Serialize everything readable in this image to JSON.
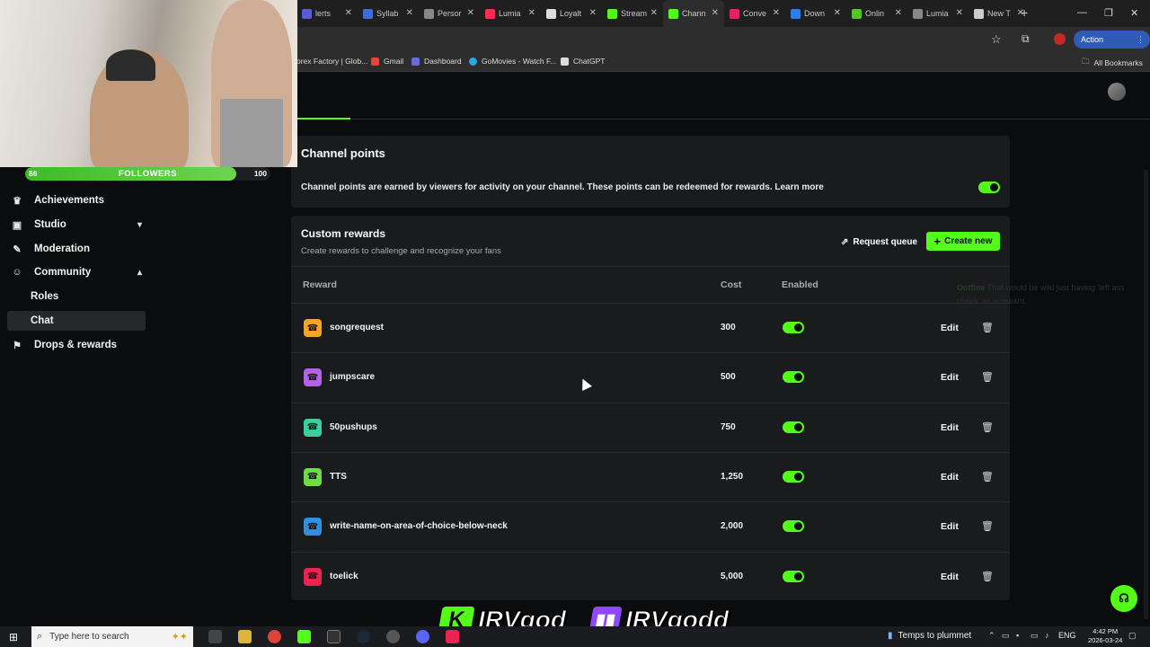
{
  "browser": {
    "tabs": [
      {
        "label": "lerts",
        "color": "#5b5bd6"
      },
      {
        "label": "Syllab",
        "color": "#3b6fd6"
      },
      {
        "label": "Persor",
        "color": "#888888"
      },
      {
        "label": "Lumia",
        "color": "#ff2d55"
      },
      {
        "label": "Loyalt",
        "color": "#dddddd"
      },
      {
        "label": "Stream",
        "color": "#53fc18"
      },
      {
        "label": "Chann",
        "color": "#53fc18"
      },
      {
        "label": "Conve",
        "color": "#e0245e"
      },
      {
        "label": "Down",
        "color": "#2b7de9"
      },
      {
        "label": "Onlin",
        "color": "#53c42b"
      },
      {
        "label": "Lumia",
        "color": "#888888"
      },
      {
        "label": "New T",
        "color": "#cccccc"
      }
    ],
    "action_required": "Action required",
    "bookmarks": [
      {
        "label": "orex Factory | Glob...",
        "color": "#cc3333"
      },
      {
        "label": "Gmail",
        "color": "#ea4335"
      },
      {
        "label": "Dashboard",
        "color": "#6a6ad6"
      },
      {
        "label": "GoMovies - Watch F...",
        "color": "#2ba6de"
      },
      {
        "label": "ChatGPT",
        "color": "#dddddd"
      }
    ],
    "all_bookmarks": "All Bookmarks"
  },
  "stream_overlay": {
    "followers_label": "FOLLOWERS",
    "followers_current": "86",
    "followers_goal": "100",
    "followers_progress": 0.86,
    "kick_name": "IRVgod",
    "twitch_name": "IRVgodd"
  },
  "sidebar": {
    "items": [
      {
        "label": "Achievements",
        "icon": "trophy-icon",
        "glyph": "🏆"
      },
      {
        "label": "Studio",
        "icon": "studio-icon",
        "glyph": "▣",
        "chevron": "⌄"
      },
      {
        "label": "Moderation",
        "icon": "wrench-icon",
        "glyph": "🔧"
      },
      {
        "label": "Community",
        "icon": "users-icon",
        "glyph": "👥",
        "chevron": "⌃"
      },
      {
        "label": "Drops & rewards",
        "icon": "gift-icon",
        "glyph": "🎁"
      }
    ],
    "sub_items": [
      "Roles",
      "Chat"
    ]
  },
  "channel_points": {
    "title": "Channel points",
    "description": "Channel points are earned by viewers for activity on your channel. These points can be redeemed for rewards. Learn more",
    "enabled": true
  },
  "custom_rewards": {
    "title": "Custom rewards",
    "subtitle": "Create rewards to challenge and recognize your fans",
    "request_queue": "Request queue",
    "create_new": "Create new",
    "columns": {
      "reward": "Reward",
      "cost": "Cost",
      "enabled": "Enabled"
    },
    "edit_label": "Edit",
    "rewards": [
      {
        "name": "songrequest",
        "cost": "300",
        "color": "#f5a623",
        "enabled": true
      },
      {
        "name": "jumpscare",
        "cost": "500",
        "color": "#b463e8",
        "enabled": true
      },
      {
        "name": "50pushups",
        "cost": "750",
        "color": "#3ccf9e",
        "enabled": true
      },
      {
        "name": "TTS",
        "cost": "1,250",
        "color": "#6edc47",
        "enabled": true
      },
      {
        "name": "write-name-on-area-of-choice-below-neck",
        "cost": "2,000",
        "color": "#2f8fe0",
        "enabled": true
      },
      {
        "name": "toelick",
        "cost": "5,000",
        "color": "#e8244f",
        "enabled": true
      }
    ]
  },
  "faded_chat": {
    "user": "Ootfine",
    "message": "That would be wild just having 'left ass cheek' as a reward."
  },
  "taskbar": {
    "search_placeholder": "Type here to search",
    "weather": "Temps to plummet",
    "language": "ENG",
    "time": "4:42 PM",
    "date": "2026-03-24"
  },
  "colors": {
    "accent": "#53fc18",
    "card_bg": "#191b1d",
    "page_bg": "#0b0c0d"
  }
}
